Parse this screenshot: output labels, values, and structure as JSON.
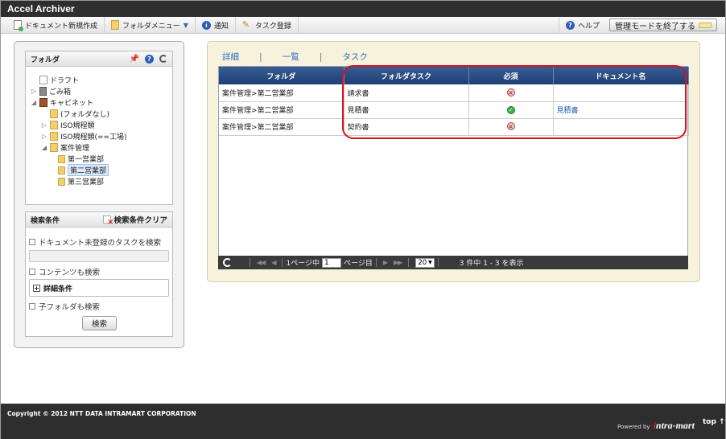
{
  "app": {
    "title": "Accel Archiver"
  },
  "toolbar": {
    "new_document": "ドキュメント新規作成",
    "folder_menu": "フォルダメニュー",
    "notification": "通知",
    "task_register": "タスク登録",
    "help": "ヘルプ",
    "exit_admin": "管理モードを終了する"
  },
  "folder_panel": {
    "title": "フォルダ",
    "tree": [
      {
        "label": "ドラフト"
      },
      {
        "label": "ごみ箱"
      },
      {
        "label": "キャビネット"
      },
      {
        "label": "(フォルダなし)"
      },
      {
        "label": "ISO規程類"
      },
      {
        "label": "ISO規程類(==工場)"
      },
      {
        "label": "案件管理"
      },
      {
        "label": "第一営業部"
      },
      {
        "label": "第二営業部",
        "selected": true
      },
      {
        "label": "第三営業部"
      }
    ]
  },
  "search_panel": {
    "title": "検索条件",
    "clear_label": "検索条件クリア",
    "opt_unregistered": "ドキュメント未登録のタスクを検索",
    "opt_content": "コンテンツも検索",
    "detail_label": "詳細条件",
    "opt_subfolder": "子フォルダも検索",
    "search_button": "検索"
  },
  "tabs": {
    "detail": "詳細",
    "list": "一覧",
    "task": "タスク"
  },
  "grid": {
    "columns": [
      "フォルダ",
      "フォルダタスク",
      "必須",
      "ドキュメント名"
    ],
    "rows": [
      {
        "folder": "案件管理>第二営業部",
        "task": "請求書",
        "required": "no",
        "document": ""
      },
      {
        "folder": "案件管理>第二営業部",
        "task": "見積書",
        "required": "ok",
        "document": "見積書"
      },
      {
        "folder": "案件管理>第二営業部",
        "task": "契約書",
        "required": "no",
        "document": ""
      }
    ]
  },
  "pager": {
    "page_prefix": "1ページ中",
    "page_value": "1",
    "page_suffix": "ページ目",
    "page_size": "20",
    "summary": "3 件中 1 - 3 を表示"
  },
  "footer": {
    "copyright": "Copyright © 2012 NTT DATA INTRAMART CORPORATION",
    "powered_by": "Powered by",
    "brand_i": "i",
    "brand_rest": "ntra-mart",
    "top_link": "top ↑"
  },
  "colors": {
    "header_bg": "#2e2e2e",
    "grid_header": "#2a4c82",
    "highlight_frame": "#d8121d",
    "main_panel": "#f6f2dc"
  }
}
